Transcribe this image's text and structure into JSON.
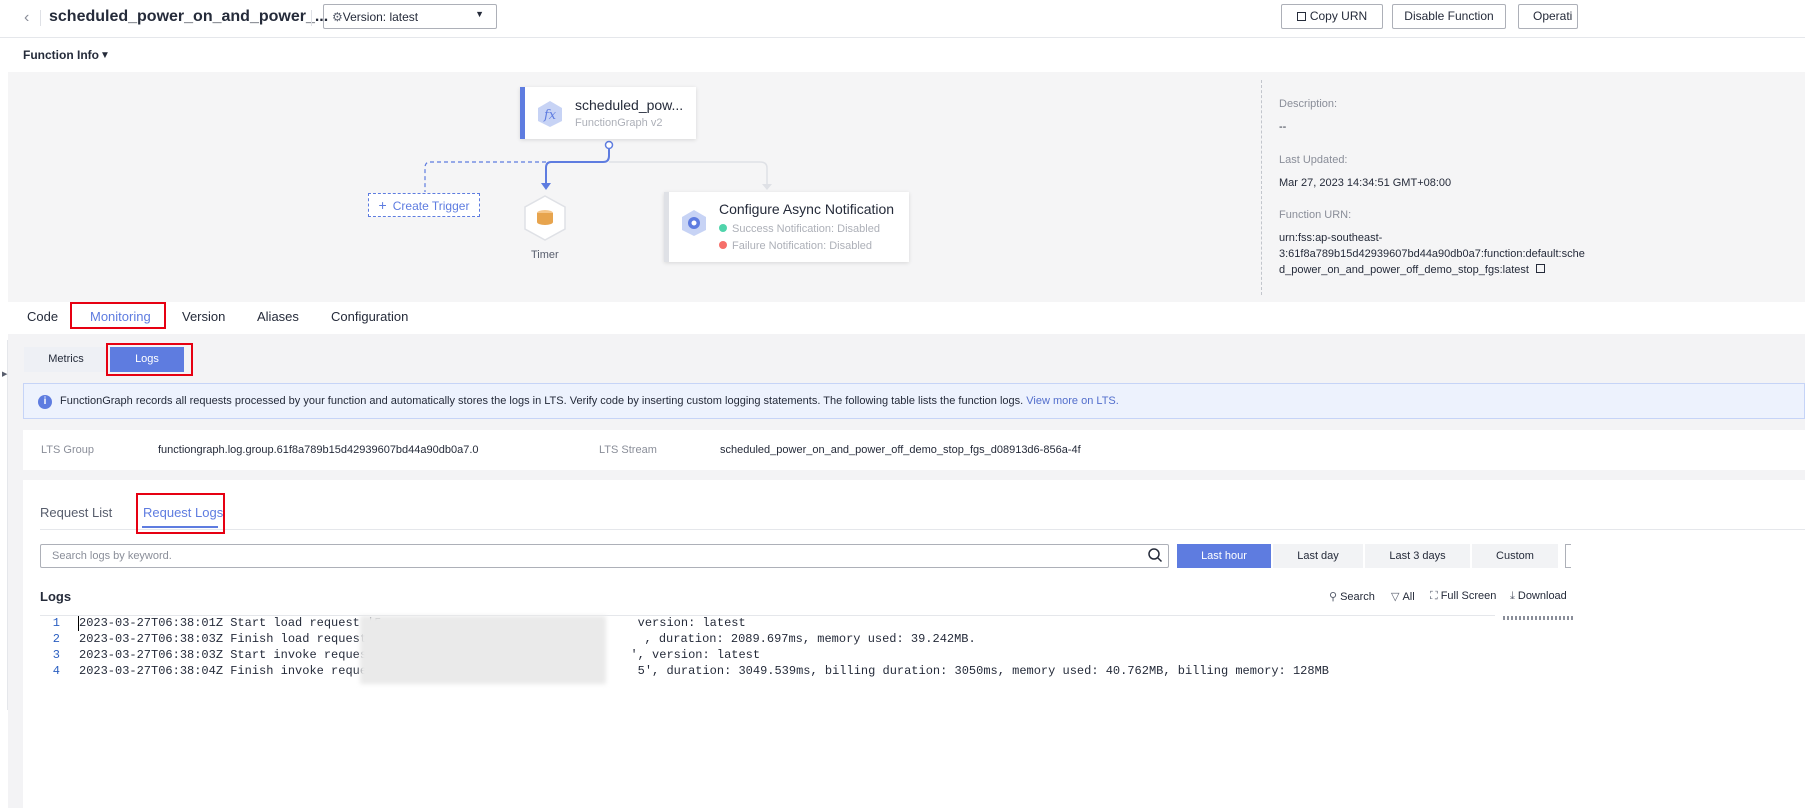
{
  "header": {
    "back_icon": "chevron-left-icon",
    "title": "scheduled_power_on_and_power_...",
    "version_select": "Version: latest",
    "copy_urn": "Copy URN",
    "disable_function": "Disable Function",
    "operations": "Operati"
  },
  "function_info": {
    "label": "Function Info",
    "function_card": {
      "name": "scheduled_pow...",
      "subtitle": "FunctionGraph v2"
    },
    "create_trigger": "Create Trigger",
    "timer_label": "Timer",
    "async": {
      "title": "Configure Async Notification",
      "success": "Success Notification: Disabled",
      "failure": "Failure Notification: Disabled",
      "success_color": "#50d4ab",
      "failure_color": "#f66f6a"
    },
    "description_label": "Description:",
    "description_value": "--",
    "last_updated_label": "Last Updated:",
    "last_updated_value": "Mar 27, 2023 14:34:51 GMT+08:00",
    "urn_label": "Function URN:",
    "urn_line1": "urn:fss:ap-southeast-",
    "urn_line2": "3:61f8a789b15d42939607bd44a90db0a7:function:default:sche",
    "urn_line3": "d_power_on_and_power_off_demo_stop_fgs:latest"
  },
  "tabs": [
    "Code",
    "Monitoring",
    "Version",
    "Aliases",
    "Configuration"
  ],
  "subtabs": {
    "metrics": "Metrics",
    "logs": "Logs"
  },
  "info_bar": {
    "text": "FunctionGraph records all requests processed by your function and automatically stores the logs in LTS. Verify code by inserting custom logging statements. The following table lists the function logs.",
    "link": "View more on LTS."
  },
  "lts": {
    "group_label": "LTS Group",
    "group_value": "functiongraph.log.group.61f8a789b15d42939607bd44a90db0a7.0",
    "stream_label": "LTS Stream",
    "stream_value": "scheduled_power_on_and_power_off_demo_stop_fgs_d08913d6-856a-4f"
  },
  "request_tabs": {
    "list": "Request List",
    "logs": "Request Logs"
  },
  "search": {
    "placeholder": "Search logs by keyword."
  },
  "time_ranges": [
    "Last hour",
    "Last day",
    "Last 3 days",
    "Custom"
  ],
  "logs_section": {
    "title": "Logs",
    "actions": [
      "Search",
      "All",
      "Full Screen",
      "Download"
    ]
  },
  "log_lines": [
    {
      "n": "1",
      "before": "2023-03-27T06:38:01Z Start load request '5",
      "after": " version: latest"
    },
    {
      "n": "2",
      "before": "2023-03-27T06:38:03Z Finish load request '",
      "after": ", duration: 2089.697ms, memory used: 39.242MB."
    },
    {
      "n": "3",
      "before": "2023-03-27T06:38:03Z Start invoke request ",
      "after": "', version: latest"
    },
    {
      "n": "4",
      "before": "2023-03-27T06:38:04Z Finish invoke request ",
      "after": "5', duration: 3049.539ms, billing duration: 3050ms, memory used: 40.762MB, billing memory: 128MB"
    }
  ]
}
